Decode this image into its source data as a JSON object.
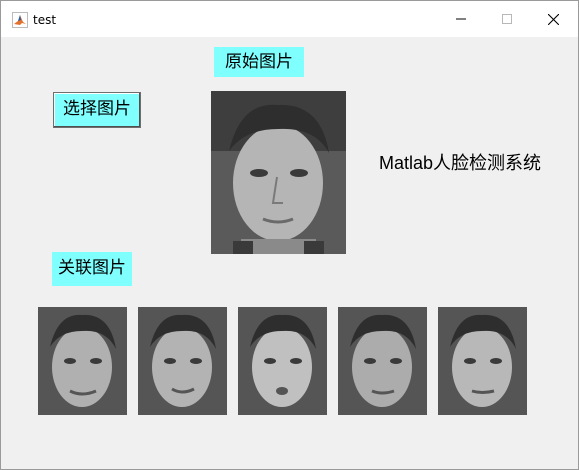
{
  "window": {
    "title": "test",
    "controls": [
      "minimize-icon",
      "maximize-icon",
      "close-icon"
    ]
  },
  "labels": {
    "original": "原始图片",
    "related": "关联图片"
  },
  "buttons": {
    "select": "选择图片"
  },
  "system_title": "Matlab人脸检测系统",
  "images": {
    "original_alt": "grayscale portrait photo",
    "related_count": 5
  },
  "colors": {
    "label_bg": "#80ffff",
    "window_bg": "#f0f0f0"
  }
}
